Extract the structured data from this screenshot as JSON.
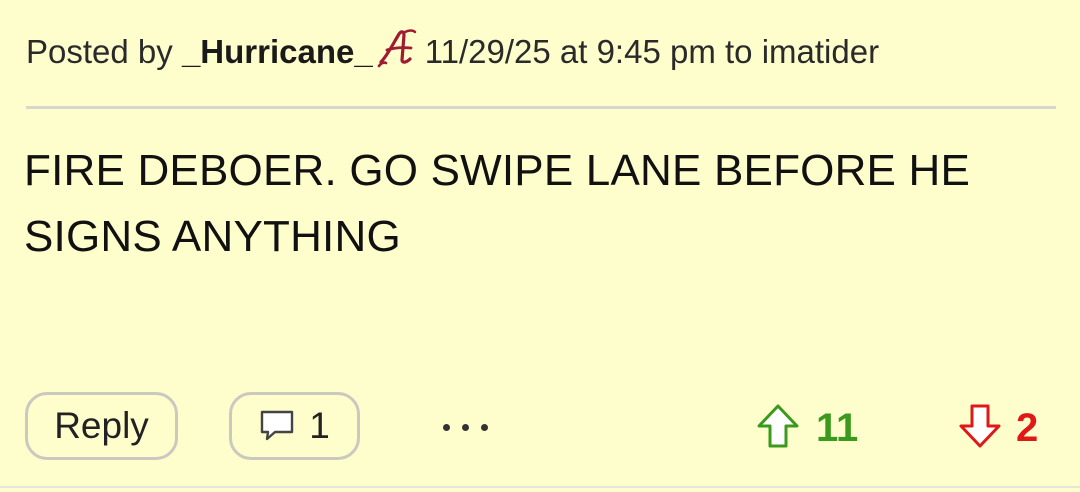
{
  "post": {
    "posted_by_prefix": "Posted by",
    "username": "_Hurricane_",
    "team_logo_icon": "alabama-script-a-icon",
    "timestamp": "11/29/25 at 9:45 pm",
    "to_text": "to",
    "reply_to_user": "imatider",
    "body_line1": "FIRE DEBOER. GO SWIPE LANE BEFORE HE",
    "body_line2": "SIGNS ANYTHING"
  },
  "actions": {
    "reply_label": "Reply",
    "comments_icon": "speech-bubble-icon",
    "comments_count": "1",
    "more_icon": "ellipsis-icon",
    "upvote_icon": "up-arrow-icon",
    "upvote_count": "11",
    "downvote_icon": "down-arrow-icon",
    "downvote_count": "2"
  },
  "colors": {
    "background": "#fefdcc",
    "upvote": "#3a9a1c",
    "downvote": "#e01818",
    "logo": "#9e1b32"
  }
}
